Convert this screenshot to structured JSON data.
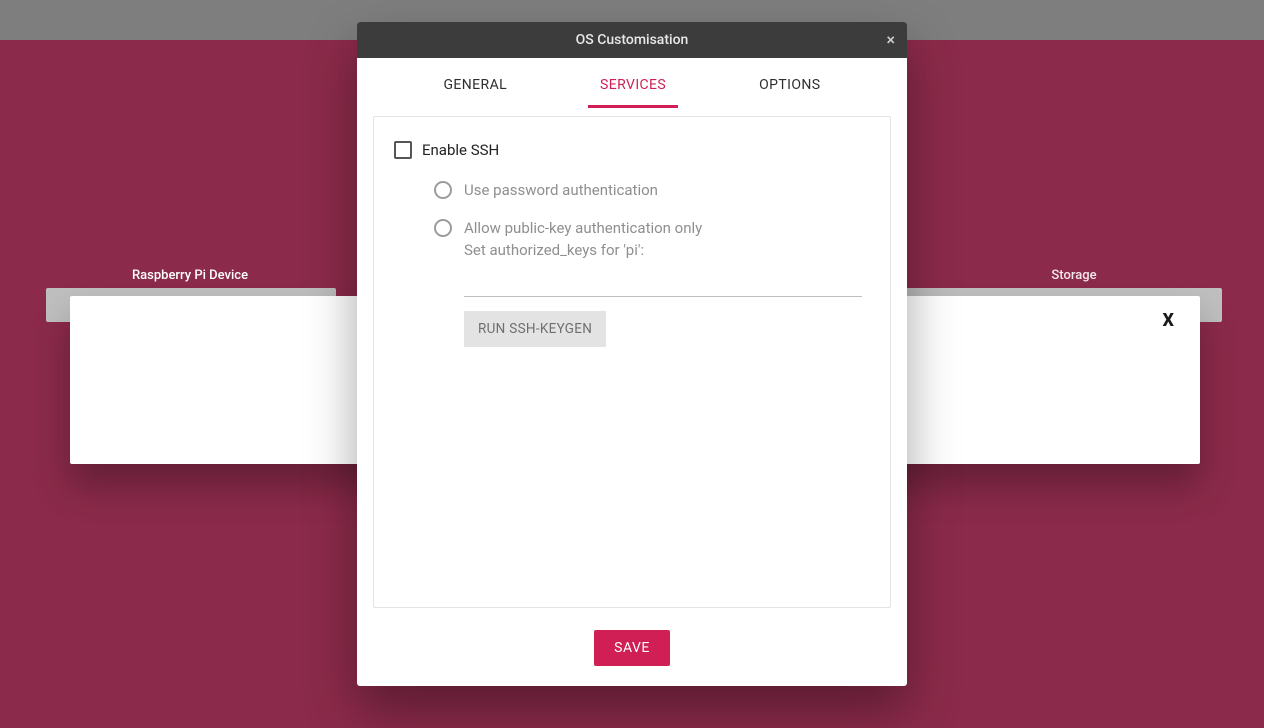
{
  "window": {
    "title": "OS Customisation",
    "close_glyph": "×"
  },
  "background": {
    "left_col_label": "Raspberry Pi Device",
    "right_col_label": "Storage",
    "clear_x": "X"
  },
  "tabs": {
    "general": "GENERAL",
    "services": "SERVICES",
    "options": "OPTIONS",
    "active": "services"
  },
  "services": {
    "enable_ssh_label": "Enable SSH",
    "enable_ssh_checked": false,
    "radio_password_label": "Use password authentication",
    "radio_pubkey_label": "Allow public-key authentication only",
    "authorized_keys_label": "Set authorized_keys for 'pi':",
    "authorized_keys_value": "",
    "keygen_button": "RUN SSH-KEYGEN"
  },
  "footer": {
    "save_label": "SAVE"
  }
}
